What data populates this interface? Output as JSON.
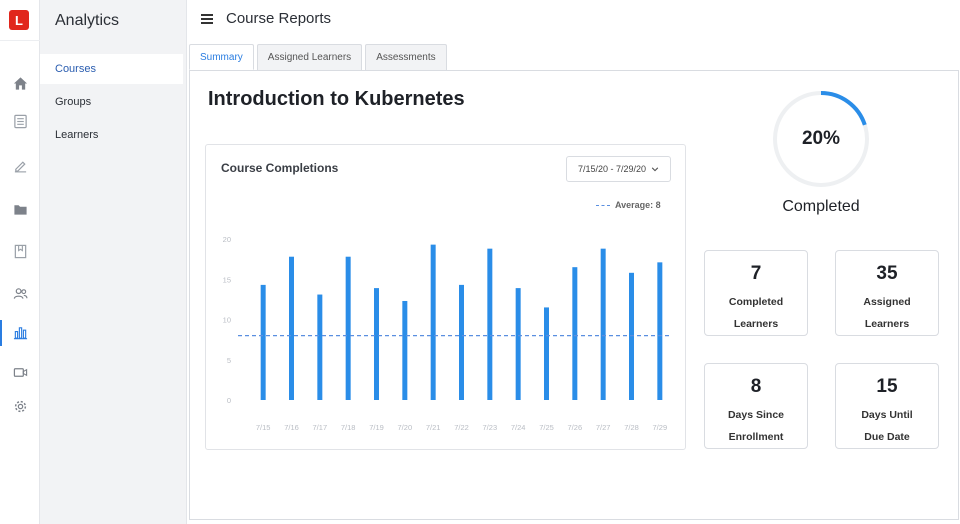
{
  "app": {
    "logo_letter": "L",
    "section_title": "Analytics"
  },
  "rail": {
    "icons": [
      "home-icon",
      "list-icon",
      "edit-icon",
      "folder-icon",
      "bookmark-icon",
      "users-icon",
      "chart-icon",
      "video-icon",
      "gear-icon"
    ],
    "active": "chart-icon"
  },
  "subnav": {
    "items": [
      {
        "label": "Courses",
        "active": true
      },
      {
        "label": "Groups",
        "active": false
      },
      {
        "label": "Learners",
        "active": false
      }
    ]
  },
  "header": {
    "menu_icon": "hamburger-icon",
    "title": "Course Reports"
  },
  "tabs": [
    {
      "label": "Summary",
      "active": true
    },
    {
      "label": "Assigned Learners",
      "active": false
    },
    {
      "label": "Assessments",
      "active": false
    }
  ],
  "course": {
    "title": "Introduction to Kubernetes"
  },
  "chart_card": {
    "title": "Course Completions",
    "date_range": "7/15/20 - 7/29/20",
    "average_label": "Average: 8"
  },
  "chart_data": {
    "type": "bar",
    "title": "Course Completions",
    "categories": [
      "7/15",
      "7/16",
      "7/17",
      "7/18",
      "7/19",
      "7/20",
      "7/21",
      "7/22",
      "7/23",
      "7/24",
      "7/25",
      "7/26",
      "7/27",
      "7/28",
      "7/29"
    ],
    "values": [
      14.3,
      17.8,
      13.1,
      17.8,
      13.9,
      12.3,
      19.3,
      14.3,
      18.8,
      13.9,
      11.5,
      16.5,
      18.8,
      15.8,
      17.1
    ],
    "ylim": [
      0,
      20
    ],
    "yticks": [
      0,
      5,
      10,
      15,
      20
    ],
    "average": 8,
    "bar_color": "#2a8de8",
    "average_color": "#5a8fe0",
    "grid": false
  },
  "completion": {
    "percent_label": "20%",
    "fraction": 0.2,
    "caption": "Completed",
    "ring_color": "#2a8de8",
    "track_color": "#eef0f2"
  },
  "stats": [
    {
      "value": "7",
      "label": "Completed\nLearners"
    },
    {
      "value": "35",
      "label": "Assigned\nLearners"
    },
    {
      "value": "8",
      "label": "Days Since\nEnrollment"
    },
    {
      "value": "15",
      "label": "Days Until\nDue Date"
    }
  ]
}
